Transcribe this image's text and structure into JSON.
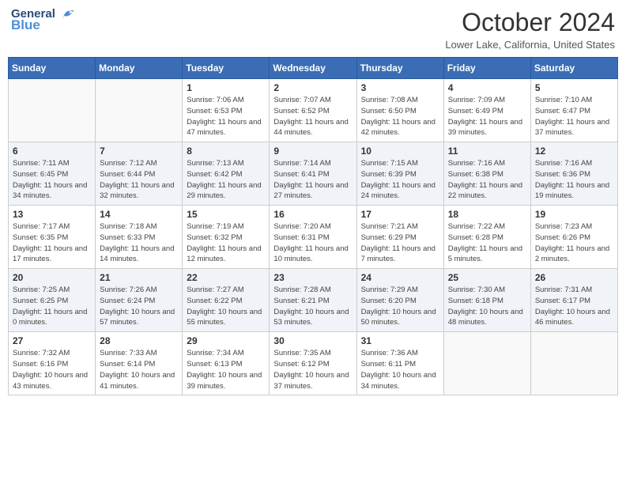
{
  "header": {
    "logo_general": "General",
    "logo_blue": "Blue",
    "title": "October 2024",
    "location": "Lower Lake, California, United States"
  },
  "columns": [
    "Sunday",
    "Monday",
    "Tuesday",
    "Wednesday",
    "Thursday",
    "Friday",
    "Saturday"
  ],
  "weeks": [
    [
      {
        "day": "",
        "info": ""
      },
      {
        "day": "",
        "info": ""
      },
      {
        "day": "1",
        "info": "Sunrise: 7:06 AM\nSunset: 6:53 PM\nDaylight: 11 hours and 47 minutes."
      },
      {
        "day": "2",
        "info": "Sunrise: 7:07 AM\nSunset: 6:52 PM\nDaylight: 11 hours and 44 minutes."
      },
      {
        "day": "3",
        "info": "Sunrise: 7:08 AM\nSunset: 6:50 PM\nDaylight: 11 hours and 42 minutes."
      },
      {
        "day": "4",
        "info": "Sunrise: 7:09 AM\nSunset: 6:49 PM\nDaylight: 11 hours and 39 minutes."
      },
      {
        "day": "5",
        "info": "Sunrise: 7:10 AM\nSunset: 6:47 PM\nDaylight: 11 hours and 37 minutes."
      }
    ],
    [
      {
        "day": "6",
        "info": "Sunrise: 7:11 AM\nSunset: 6:45 PM\nDaylight: 11 hours and 34 minutes."
      },
      {
        "day": "7",
        "info": "Sunrise: 7:12 AM\nSunset: 6:44 PM\nDaylight: 11 hours and 32 minutes."
      },
      {
        "day": "8",
        "info": "Sunrise: 7:13 AM\nSunset: 6:42 PM\nDaylight: 11 hours and 29 minutes."
      },
      {
        "day": "9",
        "info": "Sunrise: 7:14 AM\nSunset: 6:41 PM\nDaylight: 11 hours and 27 minutes."
      },
      {
        "day": "10",
        "info": "Sunrise: 7:15 AM\nSunset: 6:39 PM\nDaylight: 11 hours and 24 minutes."
      },
      {
        "day": "11",
        "info": "Sunrise: 7:16 AM\nSunset: 6:38 PM\nDaylight: 11 hours and 22 minutes."
      },
      {
        "day": "12",
        "info": "Sunrise: 7:16 AM\nSunset: 6:36 PM\nDaylight: 11 hours and 19 minutes."
      }
    ],
    [
      {
        "day": "13",
        "info": "Sunrise: 7:17 AM\nSunset: 6:35 PM\nDaylight: 11 hours and 17 minutes."
      },
      {
        "day": "14",
        "info": "Sunrise: 7:18 AM\nSunset: 6:33 PM\nDaylight: 11 hours and 14 minutes."
      },
      {
        "day": "15",
        "info": "Sunrise: 7:19 AM\nSunset: 6:32 PM\nDaylight: 11 hours and 12 minutes."
      },
      {
        "day": "16",
        "info": "Sunrise: 7:20 AM\nSunset: 6:31 PM\nDaylight: 11 hours and 10 minutes."
      },
      {
        "day": "17",
        "info": "Sunrise: 7:21 AM\nSunset: 6:29 PM\nDaylight: 11 hours and 7 minutes."
      },
      {
        "day": "18",
        "info": "Sunrise: 7:22 AM\nSunset: 6:28 PM\nDaylight: 11 hours and 5 minutes."
      },
      {
        "day": "19",
        "info": "Sunrise: 7:23 AM\nSunset: 6:26 PM\nDaylight: 11 hours and 2 minutes."
      }
    ],
    [
      {
        "day": "20",
        "info": "Sunrise: 7:25 AM\nSunset: 6:25 PM\nDaylight: 11 hours and 0 minutes."
      },
      {
        "day": "21",
        "info": "Sunrise: 7:26 AM\nSunset: 6:24 PM\nDaylight: 10 hours and 57 minutes."
      },
      {
        "day": "22",
        "info": "Sunrise: 7:27 AM\nSunset: 6:22 PM\nDaylight: 10 hours and 55 minutes."
      },
      {
        "day": "23",
        "info": "Sunrise: 7:28 AM\nSunset: 6:21 PM\nDaylight: 10 hours and 53 minutes."
      },
      {
        "day": "24",
        "info": "Sunrise: 7:29 AM\nSunset: 6:20 PM\nDaylight: 10 hours and 50 minutes."
      },
      {
        "day": "25",
        "info": "Sunrise: 7:30 AM\nSunset: 6:18 PM\nDaylight: 10 hours and 48 minutes."
      },
      {
        "day": "26",
        "info": "Sunrise: 7:31 AM\nSunset: 6:17 PM\nDaylight: 10 hours and 46 minutes."
      }
    ],
    [
      {
        "day": "27",
        "info": "Sunrise: 7:32 AM\nSunset: 6:16 PM\nDaylight: 10 hours and 43 minutes."
      },
      {
        "day": "28",
        "info": "Sunrise: 7:33 AM\nSunset: 6:14 PM\nDaylight: 10 hours and 41 minutes."
      },
      {
        "day": "29",
        "info": "Sunrise: 7:34 AM\nSunset: 6:13 PM\nDaylight: 10 hours and 39 minutes."
      },
      {
        "day": "30",
        "info": "Sunrise: 7:35 AM\nSunset: 6:12 PM\nDaylight: 10 hours and 37 minutes."
      },
      {
        "day": "31",
        "info": "Sunrise: 7:36 AM\nSunset: 6:11 PM\nDaylight: 10 hours and 34 minutes."
      },
      {
        "day": "",
        "info": ""
      },
      {
        "day": "",
        "info": ""
      }
    ]
  ]
}
